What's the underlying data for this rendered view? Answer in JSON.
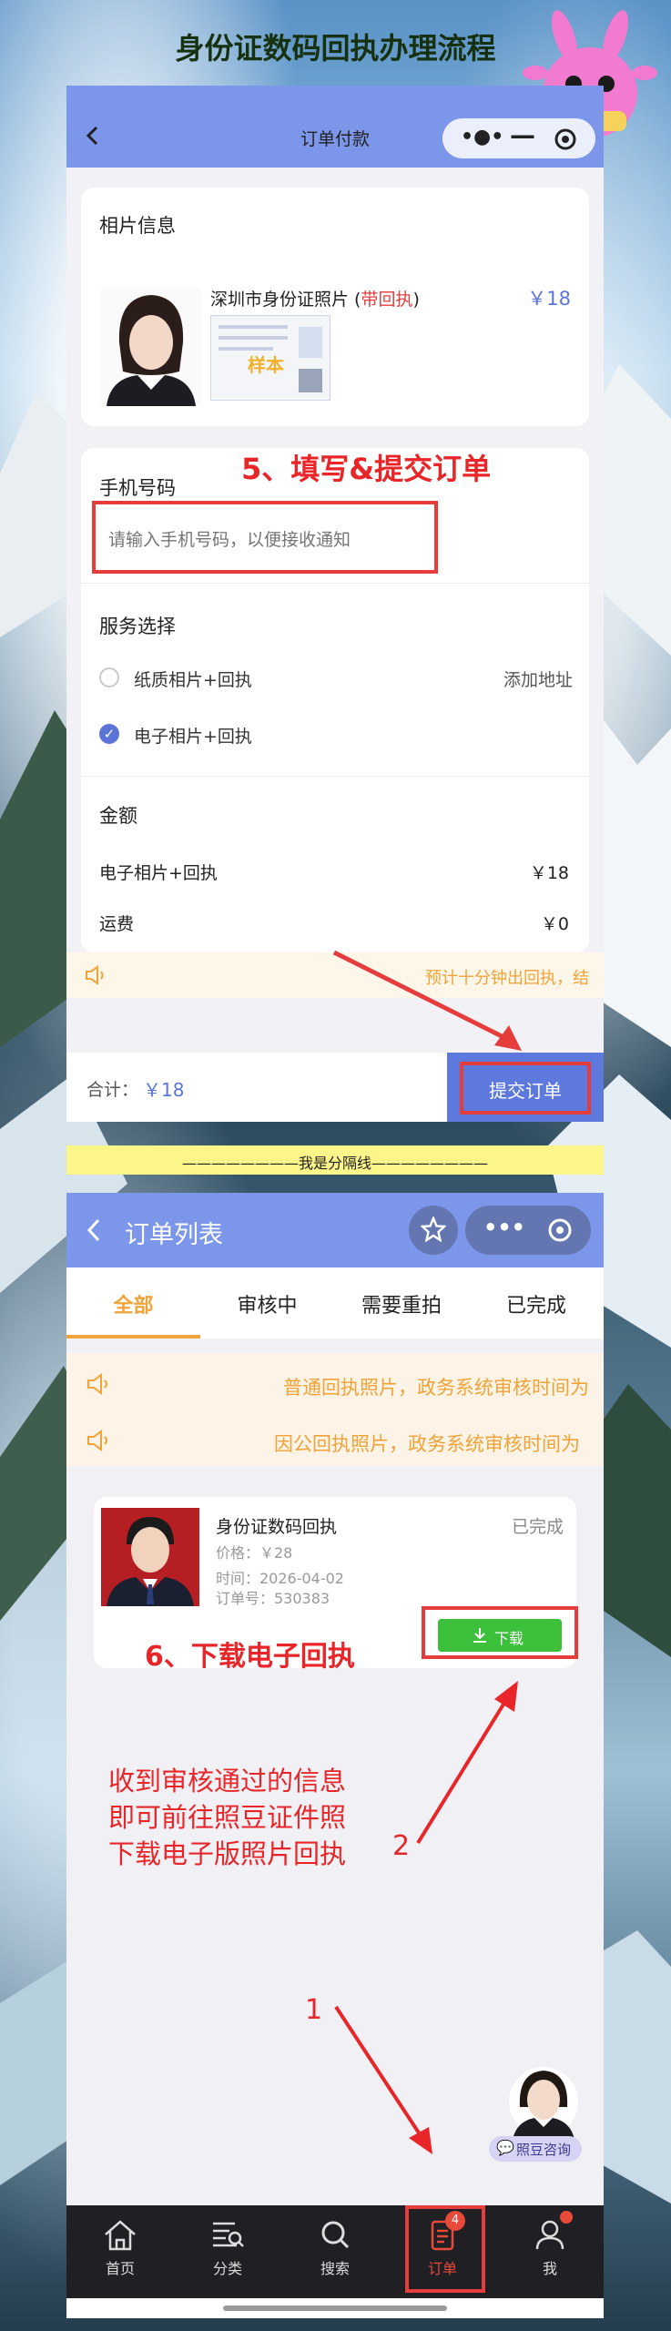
{
  "page": {
    "title": "身份证数码回执办理流程",
    "divider_text": "————————我是分隔线————————",
    "colors": {
      "accent": "#7c96e9",
      "red": "#e53c3c",
      "orange": "#f0a338",
      "green": "#3cc03c",
      "blue_price": "#5b76d8"
    }
  },
  "screen1": {
    "header": {
      "title": "订单付款",
      "back_icon": "chevron-left-icon",
      "capsule": [
        "more-icon",
        "minus-icon",
        "target-icon"
      ]
    },
    "photo_section": {
      "title": "相片信息",
      "item_name_prefix": "深圳市身份证照片 (",
      "item_tag": "带回执",
      "item_name_suffix": ")",
      "price": "￥18",
      "sample_watermark": "样本"
    },
    "phone": {
      "label": "手机号码",
      "placeholder": "请输入手机号码，以便接收通知"
    },
    "service": {
      "label": "服务选择",
      "options": [
        {
          "label": "纸质相片+回执",
          "action": "添加地址",
          "selected": false
        },
        {
          "label": "电子相片+回执",
          "action": "",
          "selected": true
        }
      ]
    },
    "amount": {
      "label": "金额",
      "rows": [
        {
          "name": "电子相片+回执",
          "value": "￥18"
        },
        {
          "name": "运费",
          "value": "￥0"
        }
      ]
    },
    "notice": "预计十分钟出回执，结",
    "footer": {
      "total_label": "合计：",
      "total_value": "￥18",
      "submit_label": "提交订单"
    },
    "annotation": "5、填写&提交订单"
  },
  "screen2": {
    "header": {
      "title": "订单列表",
      "back_icon": "chevron-left-icon",
      "capsule": [
        "star-icon",
        "more-icon",
        "target-icon"
      ]
    },
    "tabs": [
      {
        "label": "全部",
        "active": true
      },
      {
        "label": "审核中",
        "active": false
      },
      {
        "label": "需要重拍",
        "active": false
      },
      {
        "label": "已完成",
        "active": false
      }
    ],
    "notices": [
      "普通回执照片，政务系统审核时间为",
      "因公回执照片，政务系统审核时间为"
    ],
    "order": {
      "title": "身份证数码回执",
      "status": "已完成",
      "price": "价格：￥28",
      "time": "时间：2026-04-02",
      "order_no": "订单号：530383",
      "download_label": "下载"
    },
    "annotations": {
      "step6": "6、下载电子回执",
      "note_lines": [
        "收到审核通过的信息",
        "即可前往照豆证件照",
        "下载电子版照片回执"
      ],
      "num1": "1",
      "num2": "2"
    },
    "consult_label": "照豆咨询",
    "tabbar": [
      {
        "label": "首页",
        "icon": "home-icon",
        "badge": ""
      },
      {
        "label": "分类",
        "icon": "category-icon",
        "badge": ""
      },
      {
        "label": "搜索",
        "icon": "search-icon",
        "badge": ""
      },
      {
        "label": "订单",
        "icon": "order-icon",
        "badge": "4"
      },
      {
        "label": "我",
        "icon": "user-icon",
        "badge": ""
      }
    ]
  }
}
